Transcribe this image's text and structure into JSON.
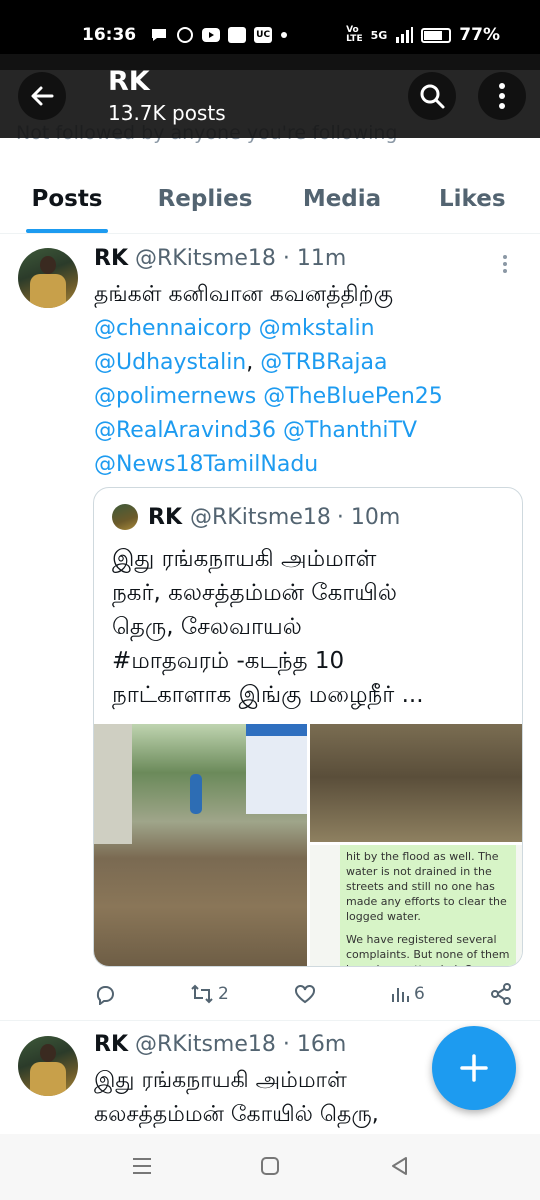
{
  "status_bar": {
    "time": "16:36",
    "battery": "77%",
    "network": "5G",
    "uc_label": "UC"
  },
  "header": {
    "name": "RK",
    "post_count": "13.7K posts",
    "followed_note": "Not followed by anyone you're following"
  },
  "tabs": [
    {
      "label": "Posts",
      "active": true
    },
    {
      "label": "Replies",
      "active": false
    },
    {
      "label": "Media",
      "active": false
    },
    {
      "label": "Likes",
      "active": false
    }
  ],
  "tweet1": {
    "name": "RK",
    "handle": "@RKitsme18",
    "time": "· 11m",
    "text_line1": "தங்கள் கனிவான கவனத்திற்கு",
    "mentions": [
      "@chennaicorp",
      "@mkstalin",
      "@Udhaystalin",
      "@TRBRajaa",
      "@polimernews",
      "@TheBluePen25",
      "@RealAravind36",
      "@ThanthiTV",
      "@News18TamilNadu"
    ],
    "separator": ",",
    "quote": {
      "name": "RK",
      "handle": "@RKitsme18",
      "time": "· 10m",
      "line1": "இது ரங்கநாயகி அம்மாள்",
      "line2": "நகர், கலசத்தம்மன்  கோயில்",
      "line3": "தெரு, சேலவாயல்",
      "line4": "#மாதவரம் -கடந்த 10",
      "line5": "நாட்காளாக இங்கு மழைநீர்  ...",
      "image_note_p1": "hit by the flood as well. The water is not drained in the streets and still no one has made any efforts to clear the logged water.",
      "image_note_p2": "We have registered several complaints. But none of them have been attended. Our"
    },
    "retweets": "2",
    "views": "6"
  },
  "tweet2": {
    "name": "RK",
    "handle": "@RKitsme18",
    "time": "· 16m",
    "line1": "இது ரங்கநாயகி அம்மாள்",
    "line2": "கலசத்தம்மன்  கோயில் தெரு,"
  },
  "colors": {
    "accent": "#1d9bf0",
    "text": "#0f1419",
    "muted": "#536471"
  },
  "icons": [
    "back-arrow-icon",
    "search-icon",
    "more-vertical-icon",
    "reply-icon",
    "retweet-icon",
    "like-icon",
    "views-icon",
    "share-icon",
    "compose-plus-icon"
  ]
}
